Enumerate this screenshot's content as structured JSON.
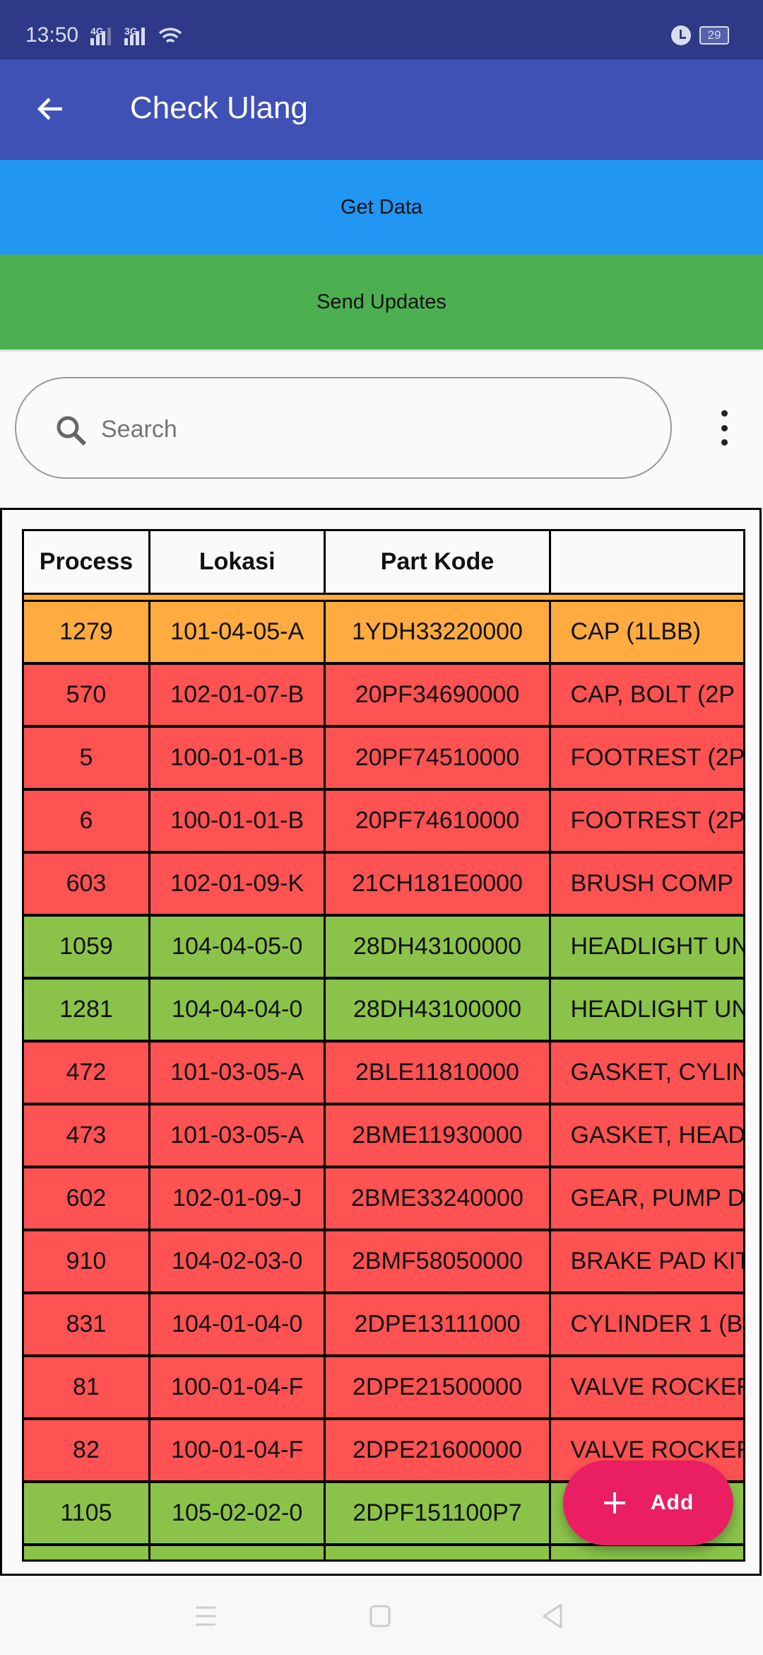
{
  "status_bar": {
    "time": "13:50",
    "network1": "4G",
    "network2": "3G",
    "battery": "29"
  },
  "app_bar": {
    "title": "Check Ulang"
  },
  "buttons": {
    "get_data": "Get Data",
    "send_updates": "Send Updates"
  },
  "search": {
    "placeholder": "Search",
    "value": ""
  },
  "colors": {
    "orange": "#FFAB40",
    "red": "#FF5252",
    "green": "#8BC34A",
    "app_bar": "#3F51B5",
    "get_data": "#2196F3",
    "send_updates": "#4CAF50",
    "fab": "#E91E63"
  },
  "table": {
    "headers": [
      "Process",
      "Lokasi",
      "Part Kode",
      ""
    ],
    "rows": [
      {
        "status": "orange",
        "cells": [
          "1279",
          "101-04-05-A",
          "1YDH33220000",
          "CAP (1LBB)"
        ]
      },
      {
        "status": "red",
        "cells": [
          "570",
          "102-01-07-B",
          "20PF34690000",
          "CAP, BOLT (2P"
        ]
      },
      {
        "status": "red",
        "cells": [
          "5",
          "100-01-01-B",
          "20PF74510000",
          "FOOTREST (2P"
        ]
      },
      {
        "status": "red",
        "cells": [
          "6",
          "100-01-01-B",
          "20PF74610000",
          "FOOTREST (2P"
        ]
      },
      {
        "status": "red",
        "cells": [
          "603",
          "102-01-09-K",
          "21CH181E0000",
          "BRUSH COMP"
        ]
      },
      {
        "status": "green",
        "cells": [
          "1059",
          "104-04-05-0",
          "28DH43100000",
          "HEADLIGHT UN"
        ]
      },
      {
        "status": "green",
        "cells": [
          "1281",
          "104-04-04-0",
          "28DH43100000",
          "HEADLIGHT UN"
        ]
      },
      {
        "status": "red",
        "cells": [
          "472",
          "101-03-05-A",
          "2BLE11810000",
          "GASKET, CYLIN"
        ]
      },
      {
        "status": "red",
        "cells": [
          "473",
          "101-03-05-A",
          "2BME11930000",
          "GASKET, HEAD"
        ]
      },
      {
        "status": "red",
        "cells": [
          "602",
          "102-01-09-J",
          "2BME33240000",
          "GEAR, PUMP D"
        ]
      },
      {
        "status": "red",
        "cells": [
          "910",
          "104-02-03-0",
          "2BMF58050000",
          "BRAKE PAD KIT"
        ]
      },
      {
        "status": "red",
        "cells": [
          "831",
          "104-01-04-0",
          "2DPE13111000",
          "CYLINDER 1 (B"
        ]
      },
      {
        "status": "red",
        "cells": [
          "81",
          "100-01-04-F",
          "2DPE21500000",
          "VALVE ROCKER"
        ]
      },
      {
        "status": "red",
        "cells": [
          "82",
          "100-01-04-F",
          "2DPE21600000",
          "VALVE ROCKER"
        ]
      },
      {
        "status": "green",
        "cells": [
          "1105",
          "105-02-02-0",
          "2DPF151100P7",
          ""
        ]
      },
      {
        "status": "green",
        "cells": [
          "",
          "",
          "",
          ""
        ]
      }
    ]
  },
  "fab": {
    "label": "Add"
  }
}
